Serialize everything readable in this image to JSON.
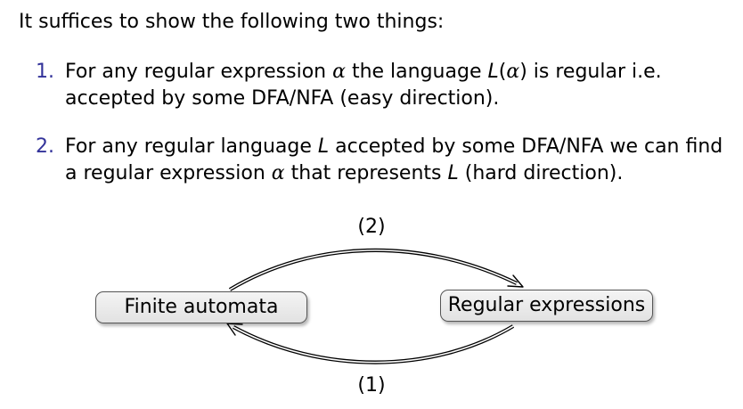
{
  "intro": "It suffices to show the following two things:",
  "items": [
    {
      "number": "1.",
      "line1_a": "For any regular expression ",
      "line1_alpha": "α",
      "line1_b": " the language ",
      "line1_L": "L",
      "line1_paren_open": "(",
      "line1_alpha2": "α",
      "line1_paren_close": ")",
      "line1_c": " is regular i.e.",
      "line2": "accepted by some DFA/NFA (easy direction)."
    },
    {
      "number": "2.",
      "line1_a": "For any regular language ",
      "line1_L": "L",
      "line1_b": " accepted by some DFA/NFA we can find",
      "line2_a": "a regular expression ",
      "line2_alpha": "α",
      "line2_b": " that represents ",
      "line2_L": "L",
      "line2_c": " (hard direction)."
    }
  ],
  "diagram": {
    "node_left": "Finite automata",
    "node_right": "Regular expressions",
    "edge_top_label": "(2)",
    "edge_bottom_label": "(1)"
  }
}
